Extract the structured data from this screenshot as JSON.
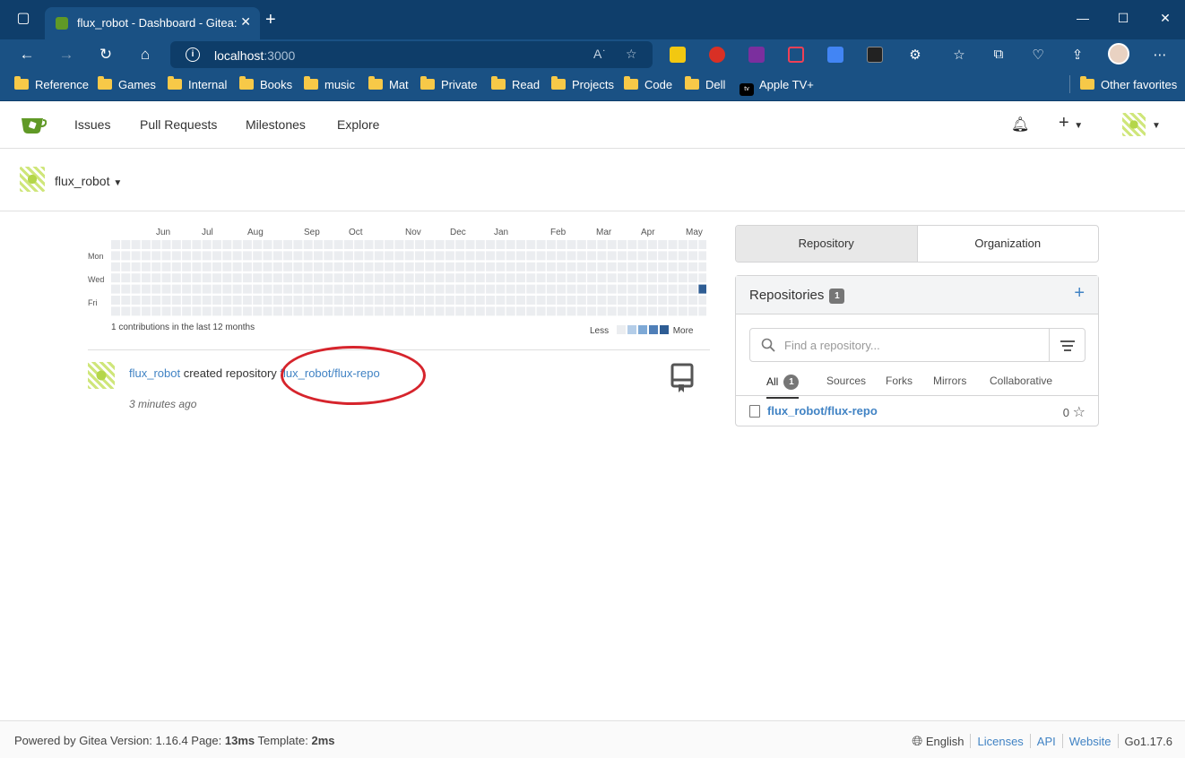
{
  "browser": {
    "tab_title": "flux_robot - Dashboard - Gitea: G",
    "url_host": "localhost",
    "url_port": ":3000",
    "bookmarks": [
      "Reference",
      "Games",
      "Internal",
      "Books",
      "music",
      "Mat",
      "Private",
      "Read",
      "Projects",
      "Code",
      "Dell",
      "Apple TV+"
    ],
    "other_favorites": "Other favorites"
  },
  "header": {
    "nav": [
      "Issues",
      "Pull Requests",
      "Milestones",
      "Explore"
    ]
  },
  "user": {
    "name": "flux_robot"
  },
  "heatmap": {
    "months": [
      "Jun",
      "Jul",
      "Aug",
      "Sep",
      "Oct",
      "Nov",
      "Dec",
      "Jan",
      "Feb",
      "Mar",
      "Apr",
      "May"
    ],
    "days": [
      "Mon",
      "Wed",
      "Fri"
    ],
    "summary": "1 contributions in the last 12 months",
    "less": "Less",
    "more": "More",
    "colors": {
      "empty": "#ebedf0",
      "levels": [
        "#ebedf0",
        "#b4cde8",
        "#7ea9d6",
        "#4f7fb8",
        "#2e5d94"
      ]
    }
  },
  "feed": {
    "actor": "flux_robot",
    "action": "created repository",
    "repo": "flux_robot/flux-repo",
    "time": "3 minutes ago"
  },
  "panel": {
    "tabs": [
      "Repository",
      "Organization"
    ],
    "title": "Repositories",
    "count": "1",
    "search_placeholder": "Find a repository...",
    "filters": [
      "All",
      "Sources",
      "Forks",
      "Mirrors",
      "Collaborative"
    ],
    "all_count": "1",
    "repos": [
      {
        "name": "flux_robot/flux-repo",
        "stars": "0"
      }
    ]
  },
  "footer": {
    "powered": "Powered by Gitea Version: 1.16.4 Page: ",
    "page_time": "13ms",
    "template_label": " Template: ",
    "template_time": "2ms",
    "language": "English",
    "links": [
      "Licenses",
      "API",
      "Website"
    ],
    "go_version": "Go1.17.6"
  }
}
